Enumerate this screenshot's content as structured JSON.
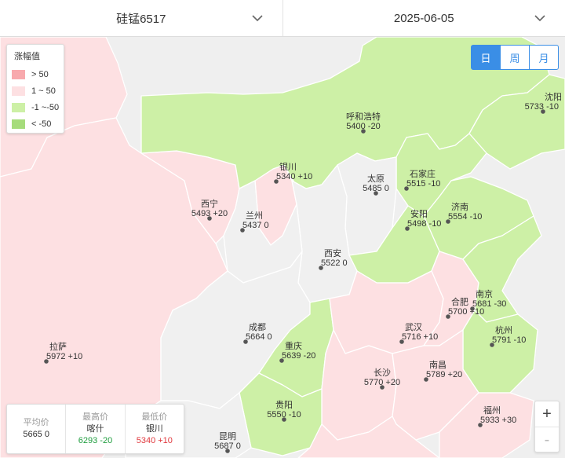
{
  "header": {
    "product": "硅锰6517",
    "date": "2025-06-05"
  },
  "legend": {
    "title": "涨幅值",
    "items": [
      {
        "label": "> 50",
        "color": "#f8a9ad"
      },
      {
        "label": "1 ~ 50",
        "color": "#fde0e2"
      },
      {
        "label": "-1 ~-50",
        "color": "#cdf0a6"
      },
      {
        "label": "< -50",
        "color": "#a6dc7c"
      }
    ]
  },
  "period_tabs": [
    {
      "label": "日",
      "active": true
    },
    {
      "label": "周",
      "active": false
    },
    {
      "label": "月",
      "active": false
    }
  ],
  "stats": {
    "avg_label": "平均价",
    "avg_value": "5665 0",
    "high_label": "最高价",
    "high_city": "喀什",
    "high_value": "6293 -20",
    "low_label": "最低价",
    "low_city": "银川",
    "low_value": "5340 +10"
  },
  "cities": [
    {
      "name": "呼和浩特",
      "value": "5400 -20"
    },
    {
      "name": "沈阳",
      "value": "5733 -10"
    },
    {
      "name": "银川",
      "value": "5340 +10"
    },
    {
      "name": "太原",
      "value": "5485 0"
    },
    {
      "name": "石家庄",
      "value": "5515 -10"
    },
    {
      "name": "西宁",
      "value": "5493 +20"
    },
    {
      "name": "兰州",
      "value": "5437 0"
    },
    {
      "name": "济南",
      "value": "5554 -10"
    },
    {
      "name": "安阳",
      "value": "5498 -10"
    },
    {
      "name": "西安",
      "value": "5522 0"
    },
    {
      "name": "合肥",
      "value": "5700 +10"
    },
    {
      "name": "南京",
      "value": "5681 -30"
    },
    {
      "name": "成都",
      "value": "5664 0"
    },
    {
      "name": "武汉",
      "value": "5716 +10"
    },
    {
      "name": "杭州",
      "value": "5791 -10"
    },
    {
      "name": "拉萨",
      "value": "5972 +10"
    },
    {
      "name": "重庆",
      "value": "5639 -20"
    },
    {
      "name": "长沙",
      "value": "5770 +20"
    },
    {
      "name": "南昌",
      "value": "5789 +20"
    },
    {
      "name": "贵阳",
      "value": "5550 -10"
    },
    {
      "name": "福州",
      "value": "5933 +30"
    },
    {
      "name": "昆明",
      "value": "5687 0"
    }
  ],
  "zoom": {
    "in": "+",
    "out": "-"
  }
}
